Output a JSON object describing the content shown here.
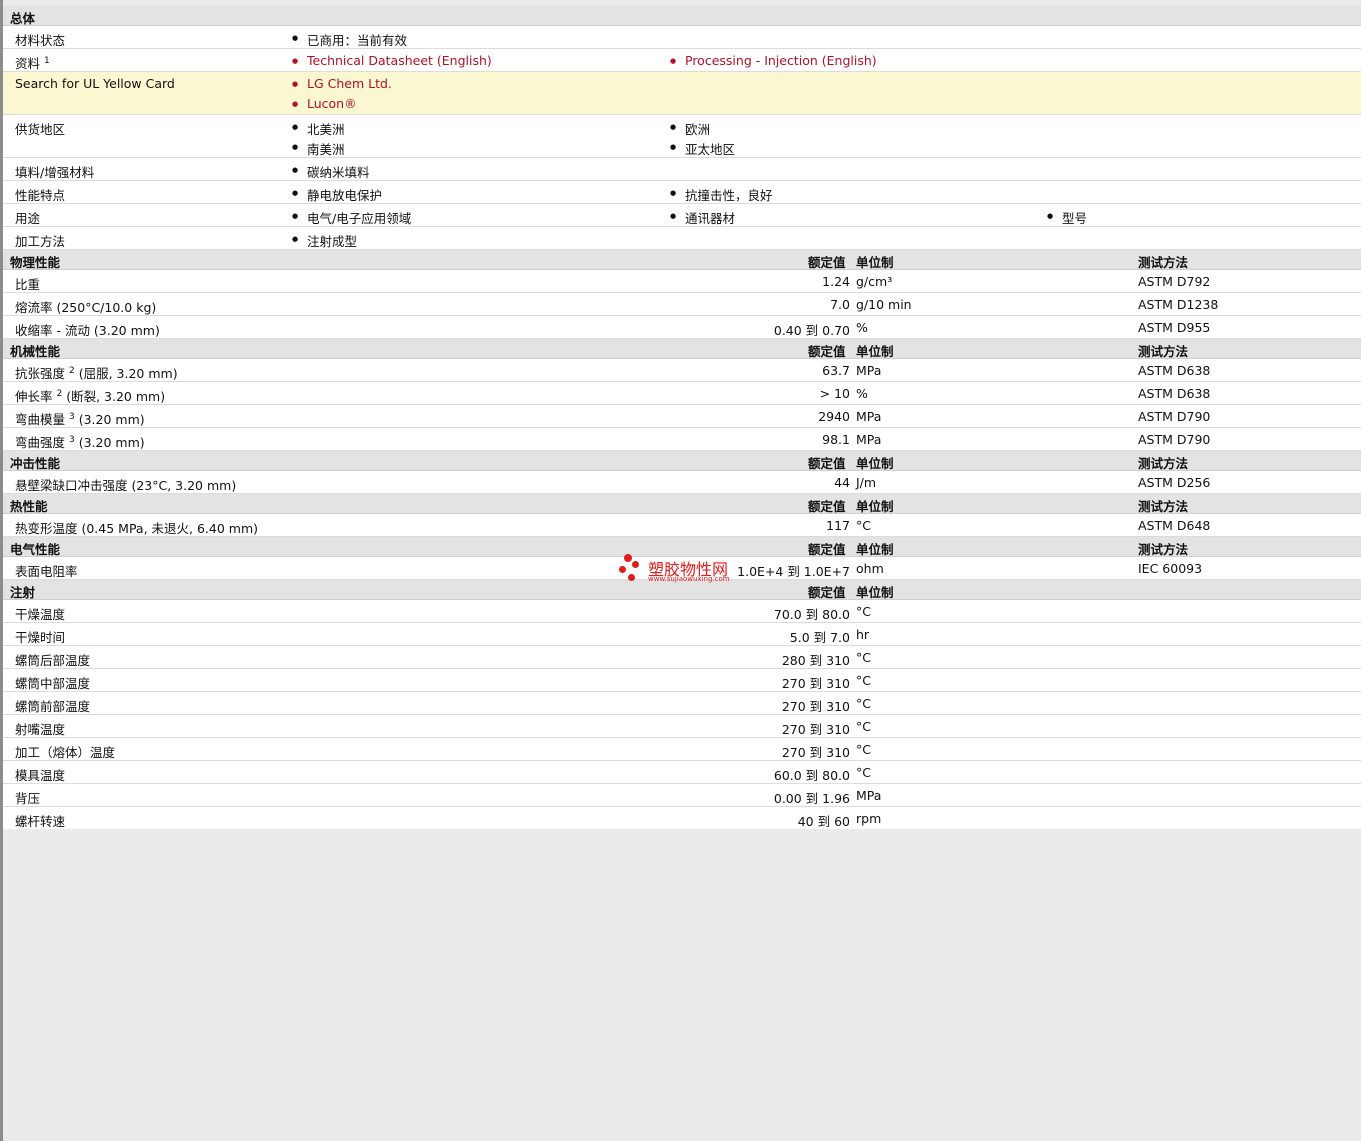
{
  "general": {
    "title": "总体",
    "rows": [
      {
        "label": "材料状态",
        "items": [
          "已商用：当前有效"
        ]
      },
      {
        "label": "资料",
        "sup": "1",
        "items": [
          "Technical Datasheet (English)",
          "Processing - Injection (English)"
        ]
      },
      {
        "label": "Search for UL Yellow Card",
        "items": [
          "LG Chem Ltd.",
          "Lucon®"
        ]
      },
      {
        "label": "供货地区",
        "items": [
          "北美洲",
          "欧洲",
          "南美洲",
          "亚太地区"
        ]
      },
      {
        "label": "填料/增强材料",
        "items": [
          "碳纳米填料"
        ]
      },
      {
        "label": "性能特点",
        "items": [
          "静电放电保护",
          "抗撞击性，良好"
        ]
      },
      {
        "label": "用途",
        "items": [
          "电气/电子应用领域",
          "通讯器材",
          "型号"
        ]
      },
      {
        "label": "加工方法",
        "items": [
          "注射成型"
        ]
      }
    ]
  },
  "headers": {
    "nominal": "额定值",
    "unit": "单位制",
    "method": "测试方法"
  },
  "physical": {
    "title": "物理性能",
    "rows": [
      {
        "label": "比重",
        "value": "1.24",
        "unit": "g/cm³",
        "method": "ASTM D792"
      },
      {
        "label": "熔流率  (250°C/10.0 kg)",
        "value": "7.0",
        "unit": "g/10 min",
        "method": "ASTM D1238"
      },
      {
        "label": "收缩率  - 流动  (3.20 mm)",
        "value": "0.40 到  0.70",
        "unit": "%",
        "method": "ASTM D955"
      }
    ]
  },
  "mechanical": {
    "title": "机械性能",
    "rows": [
      {
        "label": "抗张强度",
        "sup": "2",
        "suffix": "(屈服, 3.20 mm)",
        "value": "63.7",
        "unit": "MPa",
        "method": "ASTM D638"
      },
      {
        "label": "伸长率",
        "sup": "2",
        "suffix": "(断裂, 3.20 mm)",
        "value": "> 10",
        "unit": "%",
        "method": "ASTM D638"
      },
      {
        "label": "弯曲模量",
        "sup": "3",
        "suffix": "(3.20 mm)",
        "value": "2940",
        "unit": "MPa",
        "method": "ASTM D790"
      },
      {
        "label": "弯曲强度",
        "sup": "3",
        "suffix": "(3.20 mm)",
        "value": "98.1",
        "unit": "MPa",
        "method": "ASTM D790"
      }
    ]
  },
  "impact": {
    "title": "冲击性能",
    "rows": [
      {
        "label": "悬壁梁缺口冲击强度  (23°C, 3.20 mm)",
        "value": "44",
        "unit": "J/m",
        "method": "ASTM D256"
      }
    ]
  },
  "thermal": {
    "title": "热性能",
    "rows": [
      {
        "label": "热变形温度  (0.45 MPa, 未退火, 6.40 mm)",
        "value": "117",
        "unit": "°C",
        "method": "ASTM D648"
      }
    ]
  },
  "electrical": {
    "title": "电气性能",
    "rows": [
      {
        "label": "表面电阻率",
        "value": "1.0E+4 到  1.0E+7",
        "unit": "ohm",
        "method": "IEC 60093"
      }
    ]
  },
  "injection": {
    "title": "注射",
    "rows": [
      {
        "label": "干燥温度",
        "value": "70.0 到  80.0",
        "unit": "°C"
      },
      {
        "label": "干燥时间",
        "value": "5.0 到  7.0",
        "unit": "hr"
      },
      {
        "label": "螺筒后部温度",
        "value": "280 到  310",
        "unit": "°C"
      },
      {
        "label": "螺筒中部温度",
        "value": "270 到  310",
        "unit": "°C"
      },
      {
        "label": "螺筒前部温度",
        "value": "270 到  310",
        "unit": "°C"
      },
      {
        "label": "射嘴温度",
        "value": "270 到  310",
        "unit": "°C"
      },
      {
        "label": "加工（熔体）温度",
        "value": "270 到  310",
        "unit": "°C"
      },
      {
        "label": "模具温度",
        "value": "60.0 到  80.0",
        "unit": "°C"
      },
      {
        "label": "背压",
        "value": "0.00 到  1.96",
        "unit": "MPa"
      },
      {
        "label": "螺杆转速",
        "value": "40 到  60",
        "unit": "rpm"
      }
    ]
  },
  "watermark": {
    "title": "塑胶物性网",
    "url": "www.sujiaowuxing.com"
  }
}
